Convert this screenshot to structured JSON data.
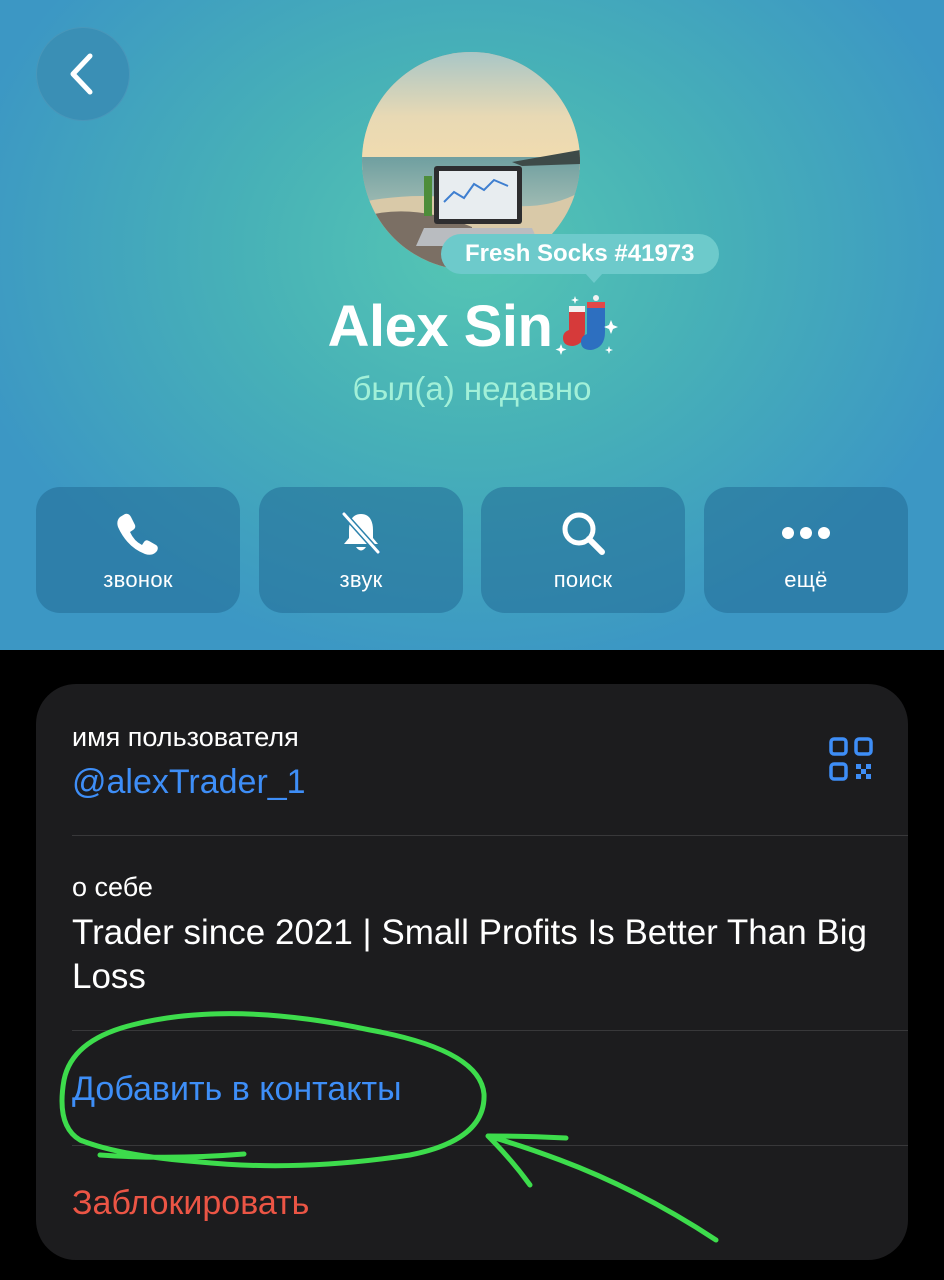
{
  "header": {
    "badge": "Fresh Socks #41973",
    "name": "Alex Sin",
    "status": "был(а) недавно"
  },
  "actions": [
    {
      "label": "звонок",
      "icon": "phone-icon"
    },
    {
      "label": "звук",
      "icon": "bell-slash-icon"
    },
    {
      "label": "поиск",
      "icon": "search-icon"
    },
    {
      "label": "ещё",
      "icon": "more-icon"
    }
  ],
  "info": {
    "username_label": "имя пользователя",
    "username": "@alexTrader_1",
    "about_label": "о себе",
    "about": "Trader since 2021 | Small Profits Is Better Than Big Loss",
    "add_contact": "Добавить в контакты",
    "block": "Заблокировать"
  },
  "colors": {
    "accent": "#3e8ef7",
    "danger": "#eb5545",
    "annotation": "#3ddc4c"
  }
}
